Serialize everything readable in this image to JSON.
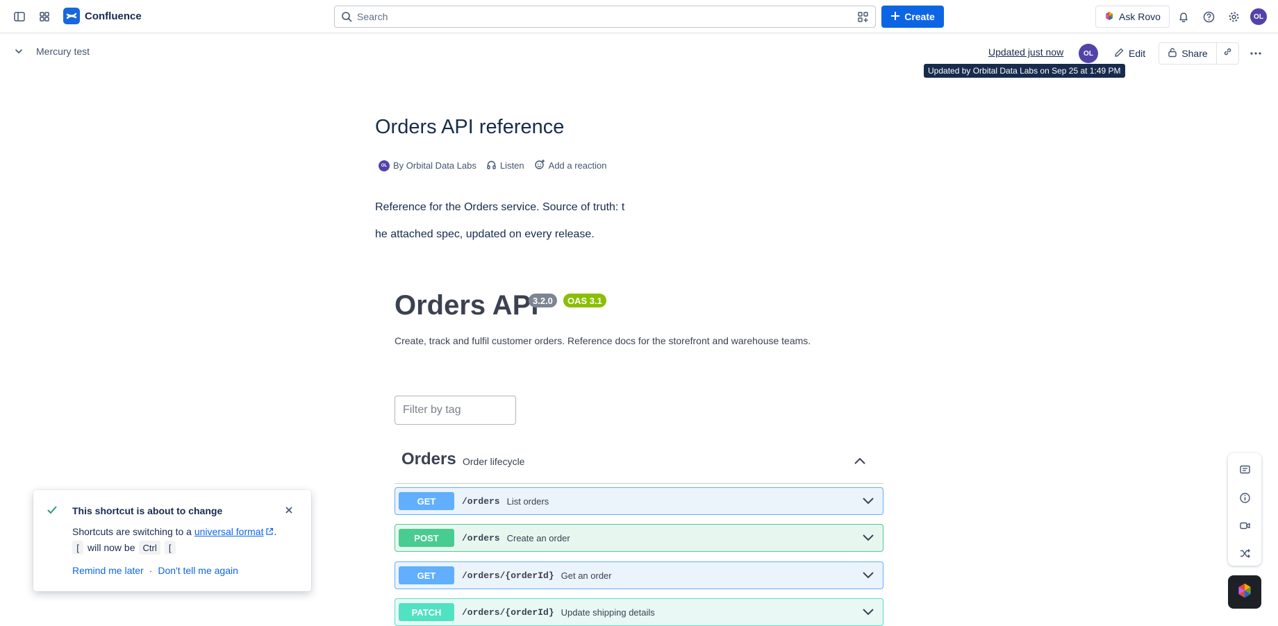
{
  "app": {
    "name": "Confluence"
  },
  "topbar": {
    "search_placeholder": "Search",
    "create_label": "Create",
    "rovo_label": "Ask Rovo",
    "user_initials": "OL",
    "accent": "#0c66e4"
  },
  "subbar": {
    "breadcrumb": "Mercury test",
    "updated": "Updated just now",
    "avatar_initials": "OL",
    "edit_label": "Edit",
    "share_label": "Share",
    "tooltip": "Updated by Orbital Data Labs on Sep 25 at 1:49 PM"
  },
  "page": {
    "title": "Orders API reference",
    "byline": {
      "author_initials": "OL",
      "author": "By Orbital Data Labs",
      "listen": "Listen",
      "reaction": "Add a reaction"
    },
    "para_line1": "Reference for the Orders service. Source of truth: t",
    "para_line2": "he attached spec, updated on every release."
  },
  "api": {
    "title": "Orders API",
    "version": "3.2.0",
    "oas": "OAS 3.1",
    "description": "Create, track and fulfil customer orders. Reference docs for the storefront and warehouse teams.",
    "filter_placeholder": "Filter by tag",
    "tag": {
      "name": "Orders",
      "description": "Order lifecycle"
    },
    "operations": [
      {
        "method": "GET",
        "path": "/orders",
        "summary": "List orders"
      },
      {
        "method": "POST",
        "path": "/orders",
        "summary": "Create an order"
      },
      {
        "method": "GET",
        "path": "/orders/{orderId}",
        "summary": "Get an order"
      },
      {
        "method": "PATCH",
        "path": "/orders/{orderId}",
        "summary": "Update shipping details"
      }
    ]
  },
  "flag": {
    "title": "This shortcut is about to change",
    "line1_prefix": "Shortcuts are switching to a ",
    "line1_link": "universal format",
    "line1_suffix": ".",
    "key_old": "[",
    "will_now_be": "will now be",
    "key_mod": "Ctrl",
    "key_new": "[",
    "remind_label": "Remind me later",
    "separator": "·",
    "dismiss_label": "Don't tell me again"
  }
}
